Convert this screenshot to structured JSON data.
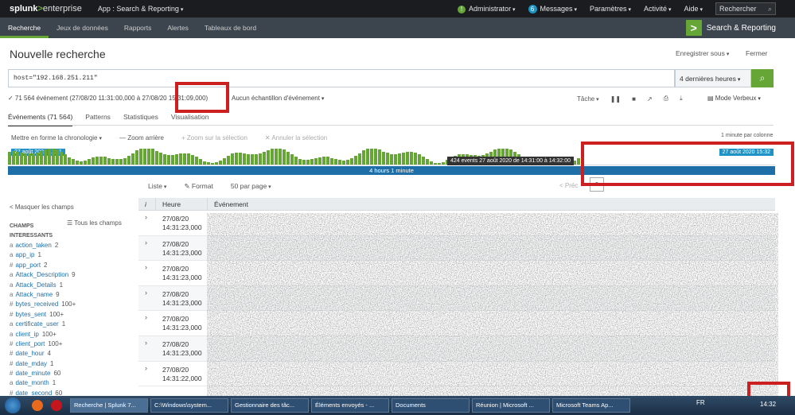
{
  "topbar": {
    "logo_main": "splunk",
    "logo_gt": ">",
    "logo_edition": "enterprise",
    "app_menu": "App : Search & Reporting",
    "administrator": "Administrator",
    "messages_count": "6",
    "messages": "Messages",
    "settings": "Paramètres",
    "activity": "Activité",
    "help": "Aide",
    "search_placeholder": "Rechercher"
  },
  "appbar": {
    "tabs": [
      "Recherche",
      "Jeux de données",
      "Rapports",
      "Alertes",
      "Tableaux de bord"
    ],
    "brand": "Search & Reporting"
  },
  "page": {
    "title": "Nouvelle recherche",
    "save_as": "Enregistrer sous",
    "close": "Fermer"
  },
  "search": {
    "query": "host=\"192.168.251.211\"",
    "time_range": "4 dernières heures",
    "event_summary": "✓ 71 564 événement (27/08/20 11:31:00,000 à 27/08/20 15:31:09,000)",
    "sampling": "Aucun échantillon d'événement",
    "job": "Tâche",
    "mode": "Mode Verbeux"
  },
  "tabs": {
    "events": "Événements (71 564)",
    "patterns": "Patterns",
    "statistics": "Statistiques",
    "visualization": "Visualisation"
  },
  "timeline_tools": {
    "format": "Mettre en forme la chronologie",
    "zoom_out": "— Zoom arrière",
    "zoom_selection": "+ Zoom sur la sélection",
    "deselect": "✕ Annuler la sélection",
    "per_column": "1 minute par colonne"
  },
  "timeline": {
    "start_label": "27 août 2020 11:31",
    "end_label": "27 août 2020 15:32",
    "range_label": "4 hours 1 minute",
    "tooltip": "424 events 27 août 2020 de 14:31:00 à 14:32:00"
  },
  "list_tools": {
    "list": "Liste",
    "format": "Format",
    "per_page": "50 par page",
    "prev": "< Préc",
    "page": "8"
  },
  "sidebar": {
    "hide_fields": "< Masquer les champs",
    "all_fields": "☰ Tous les champs",
    "section_line1": "CHAMPS",
    "section_line2": "INTERESSANTS",
    "fields": [
      {
        "type": "a",
        "name": "action_taken",
        "count": "2"
      },
      {
        "type": "a",
        "name": "app_ip",
        "count": "1"
      },
      {
        "type": "#",
        "name": "app_port",
        "count": "2"
      },
      {
        "type": "a",
        "name": "Attack_Description",
        "count": "9"
      },
      {
        "type": "a",
        "name": "Attack_Details",
        "count": "1"
      },
      {
        "type": "a",
        "name": "Attack_name",
        "count": "9"
      },
      {
        "type": "#",
        "name": "bytes_received",
        "count": "100+"
      },
      {
        "type": "#",
        "name": "bytes_sent",
        "count": "100+"
      },
      {
        "type": "a",
        "name": "certificate_user",
        "count": "1"
      },
      {
        "type": "a",
        "name": "client_ip",
        "count": "100+"
      },
      {
        "type": "#",
        "name": "client_port",
        "count": "100+"
      },
      {
        "type": "#",
        "name": "date_hour",
        "count": "4"
      },
      {
        "type": "#",
        "name": "date_mday",
        "count": "1"
      },
      {
        "type": "#",
        "name": "date_minute",
        "count": "60"
      },
      {
        "type": "a",
        "name": "date_month",
        "count": "1"
      },
      {
        "type": "#",
        "name": "date_second",
        "count": "60"
      }
    ]
  },
  "table": {
    "col_info": "i",
    "col_time": "Heure",
    "col_event": "Événement",
    "rows": [
      {
        "date": "27/08/20",
        "time": "14:31:23,000"
      },
      {
        "date": "27/08/20",
        "time": "14:31:23,000"
      },
      {
        "date": "27/08/20",
        "time": "14:31:23,000"
      },
      {
        "date": "27/08/20",
        "time": "14:31:23,000"
      },
      {
        "date": "27/08/20",
        "time": "14:31:23,000"
      },
      {
        "date": "27/08/20",
        "time": "14:31:23,000"
      },
      {
        "date": "27/08/20",
        "time": "14:31:22,000"
      }
    ]
  },
  "taskbar": {
    "tasks": [
      "Recherche | Splunk 7...",
      "C:\\Windows\\system...",
      "Gestionnaire des tâc...",
      "Éléments envoyés - ...",
      "Documents",
      "Réunion | Microsoft ...",
      "Microsoft Teams Ap..."
    ],
    "lang": "FR",
    "clock": "14:32"
  },
  "colors": {
    "accent_green": "#65a637",
    "accent_blue": "#1e93c6",
    "highlight_red": "#cc1f1f",
    "topbar_bg": "#1a1c20",
    "appbar_bg": "#3c444d"
  }
}
